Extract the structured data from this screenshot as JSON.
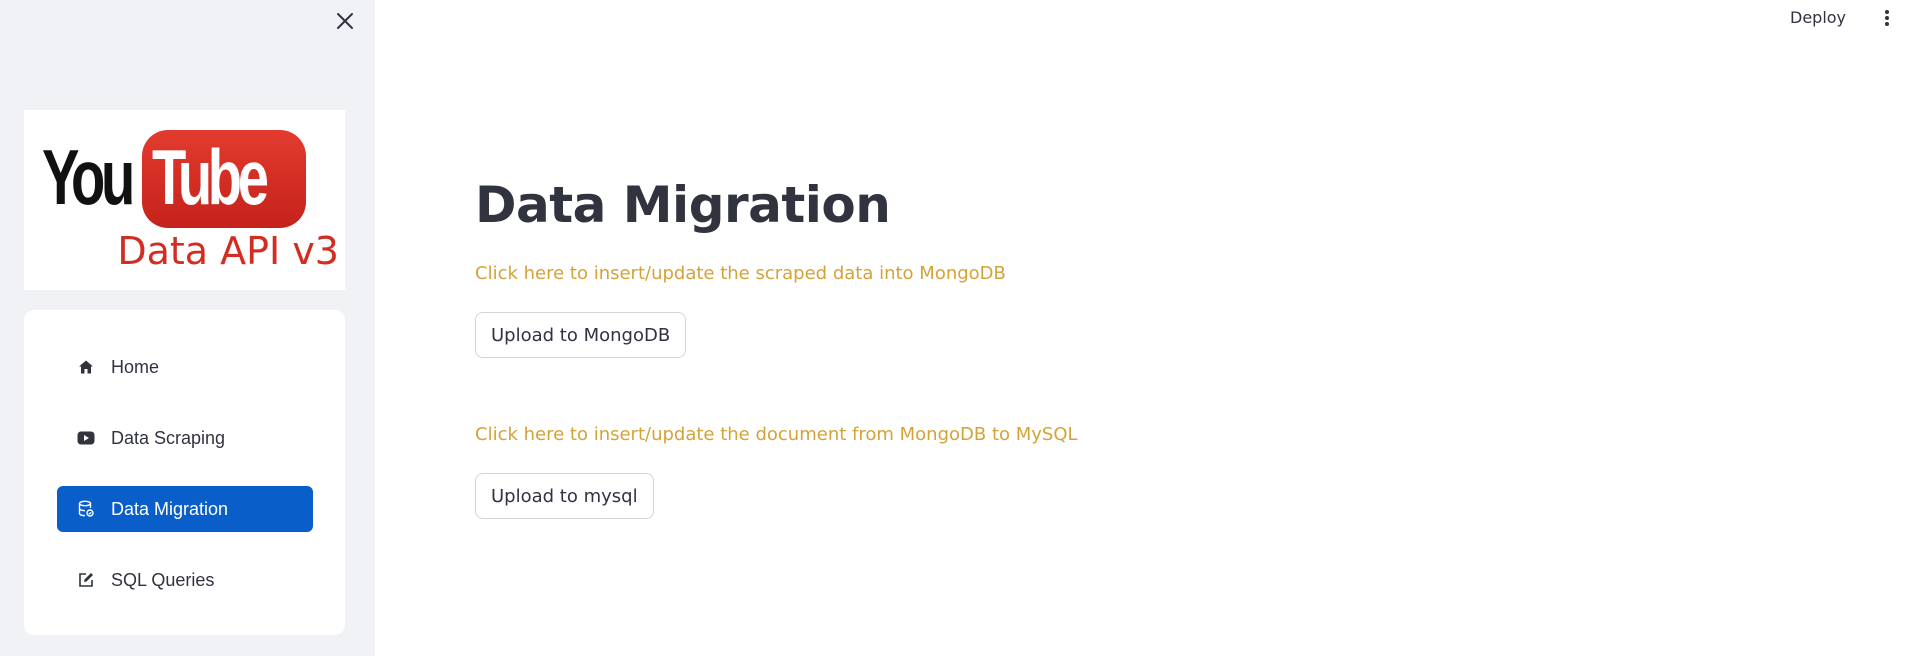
{
  "sidebar": {
    "close_icon": "close-icon",
    "logo": {
      "you": "You",
      "tube": "Tube",
      "subtitle": "Data API v3"
    },
    "menu": [
      {
        "label": "Home",
        "icon": "home-icon",
        "active": false
      },
      {
        "label": "Data Scraping",
        "icon": "youtube-icon",
        "active": false
      },
      {
        "label": "Data Migration",
        "icon": "database-icon",
        "active": true
      },
      {
        "label": "SQL Queries",
        "icon": "edit-icon",
        "active": false
      }
    ],
    "active_color": "#0a5ec9"
  },
  "header": {
    "deploy_label": "Deploy",
    "menu_icon": "kebab-menu-icon"
  },
  "main": {
    "title": "Data Migration",
    "mongo_hint": "Click here to insert/update the scraped data into MongoDB",
    "mongo_button": "Upload to MongoDB",
    "mysql_hint": "Click here to insert/update the document from MongoDB to MySQL",
    "mysql_button": "Upload to mysql",
    "hint_color": "#d4a338"
  }
}
